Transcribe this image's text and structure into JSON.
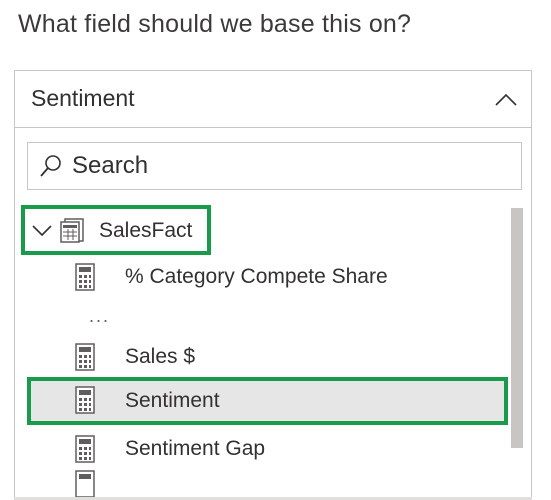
{
  "question": "What field should we base this on?",
  "dropdown": {
    "selected_value": "Sentiment"
  },
  "search": {
    "placeholder": "Search",
    "value": ""
  },
  "tree": {
    "group_label": "SalesFact",
    "items": [
      {
        "label": "% Category Compete Share",
        "icon": "calculator-icon"
      },
      {
        "label": "...",
        "icon": ""
      },
      {
        "label": "Sales $",
        "icon": "calculator-icon"
      },
      {
        "label": "Sentiment",
        "icon": "calculator-icon",
        "selected": true
      },
      {
        "label": "Sentiment Gap",
        "icon": "calculator-icon"
      }
    ]
  },
  "colors": {
    "highlight_border": "#1a9b4b",
    "selected_background": "#e6e6e6",
    "border": "#c8c6c4"
  }
}
